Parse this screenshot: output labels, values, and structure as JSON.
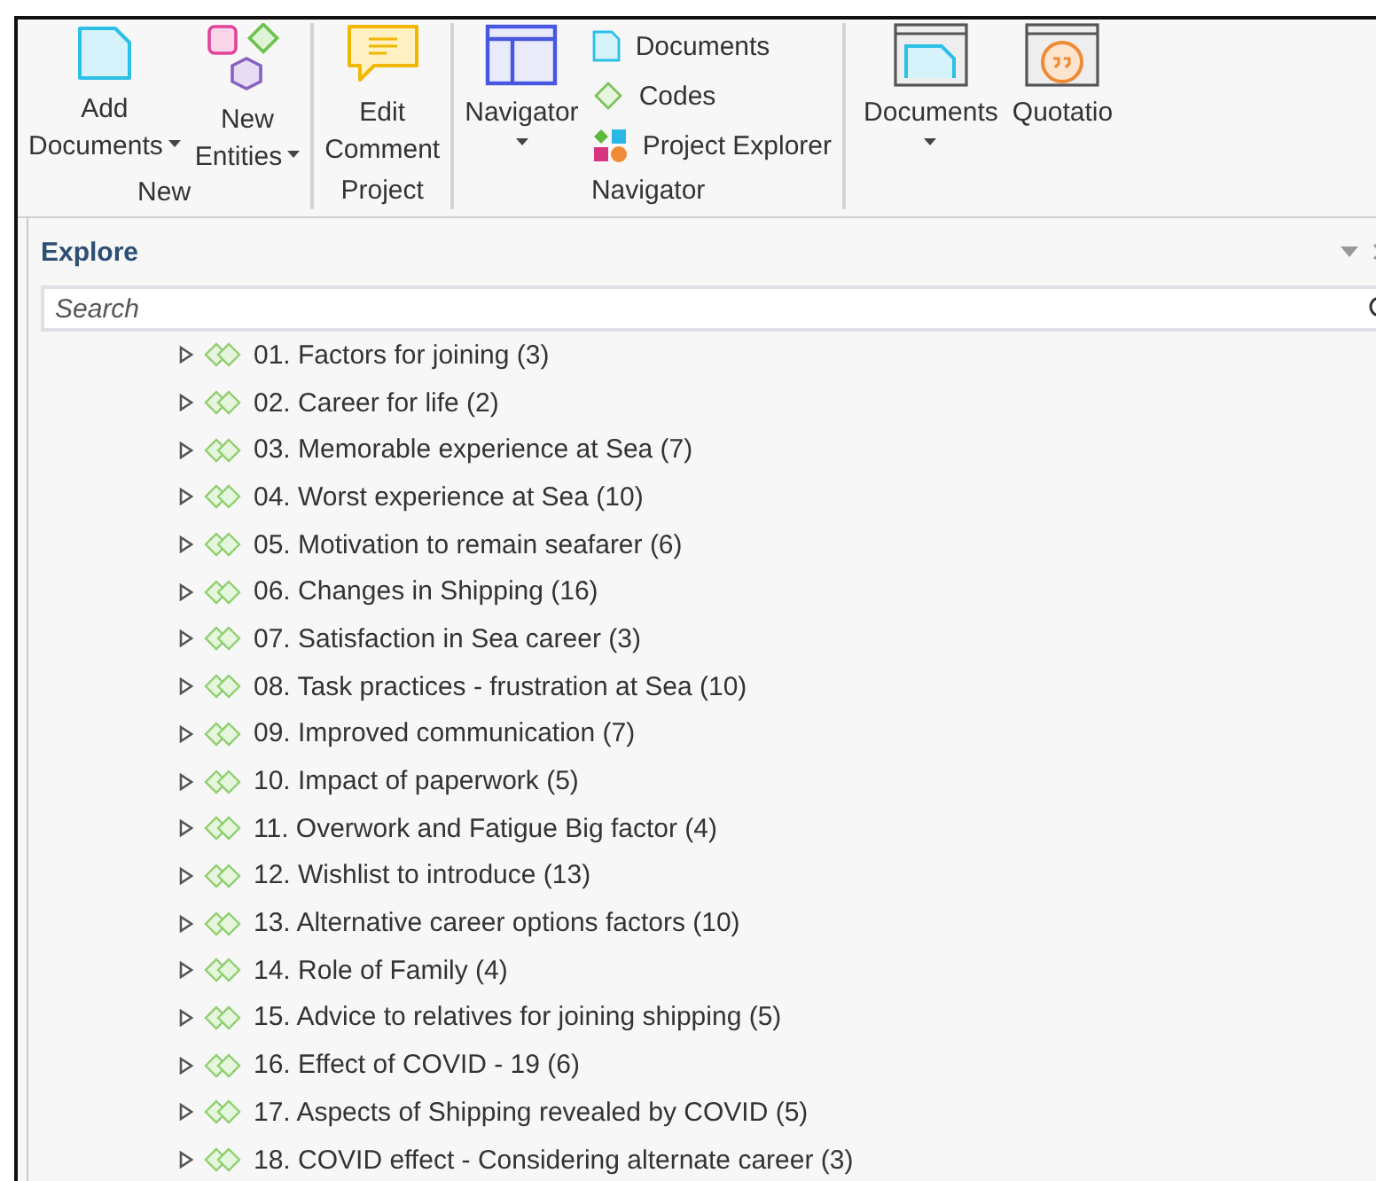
{
  "ribbon": {
    "groups": [
      {
        "label": "New",
        "buttons": [
          {
            "kind": "add-documents",
            "lines": [
              "Add",
              "Documents"
            ],
            "dropdown": true
          },
          {
            "kind": "new-entities",
            "lines": [
              "New",
              "Entities"
            ],
            "dropdown": true
          }
        ]
      },
      {
        "label": "Project",
        "buttons": [
          {
            "kind": "comment",
            "lines": [
              "Edit",
              "Comment"
            ],
            "dropdown": false
          }
        ]
      },
      {
        "label": "Navigator",
        "buttons": [
          {
            "kind": "navigator",
            "lines": [
              "Navigator"
            ],
            "dropdown": true
          }
        ],
        "small_items": [
          {
            "kind": "document",
            "label": "Documents"
          },
          {
            "kind": "code",
            "label": "Codes"
          },
          {
            "kind": "explorer",
            "label": "Project Explorer"
          }
        ]
      },
      {
        "buttons": [
          {
            "kind": "documents-view",
            "lines": [
              "Documents"
            ],
            "dropdown": true
          },
          {
            "kind": "quotation-view",
            "lines": [
              "Quotatio"
            ],
            "dropdown": false
          }
        ]
      }
    ]
  },
  "explore": {
    "title": "Explore",
    "search": {
      "placeholder": "Search"
    },
    "items": [
      {
        "label": "01. Factors for joining (3)",
        "expanded": false
      },
      {
        "label": "02. Career for life (2)",
        "expanded": false
      },
      {
        "label": "03. Memorable experience at Sea (7)",
        "expanded": false
      },
      {
        "label": "04. Worst experience at Sea (10)",
        "expanded": false
      },
      {
        "label": "05. Motivation to remain seafarer (6)",
        "expanded": false
      },
      {
        "label": "06. Changes in Shipping (16)",
        "expanded": false
      },
      {
        "label": "07. Satisfaction in Sea career (3)",
        "expanded": false
      },
      {
        "label": "08. Task practices - frustration at Sea (10)",
        "expanded": false
      },
      {
        "label": "09. Improved communication (7)",
        "expanded": false
      },
      {
        "label": "10. Impact of paperwork (5)",
        "expanded": false
      },
      {
        "label": "11. Overwork and Fatigue Big factor (4)",
        "expanded": false
      },
      {
        "label": "12. Wishlist to introduce (13)",
        "expanded": false
      },
      {
        "label": "13. Alternative career options factors (10)",
        "expanded": false
      },
      {
        "label": "14. Role of Family (4)",
        "expanded": false
      },
      {
        "label": "15. Advice to relatives for joining shipping (5)",
        "expanded": false
      },
      {
        "label": "16. Effect of COVID - 19 (6)",
        "expanded": false
      },
      {
        "label": "17. Aspects of Shipping revealed by COVID (5)",
        "expanded": false
      },
      {
        "label": "18. COVID effect - Considering alternate career (3)",
        "expanded": false
      }
    ]
  }
}
